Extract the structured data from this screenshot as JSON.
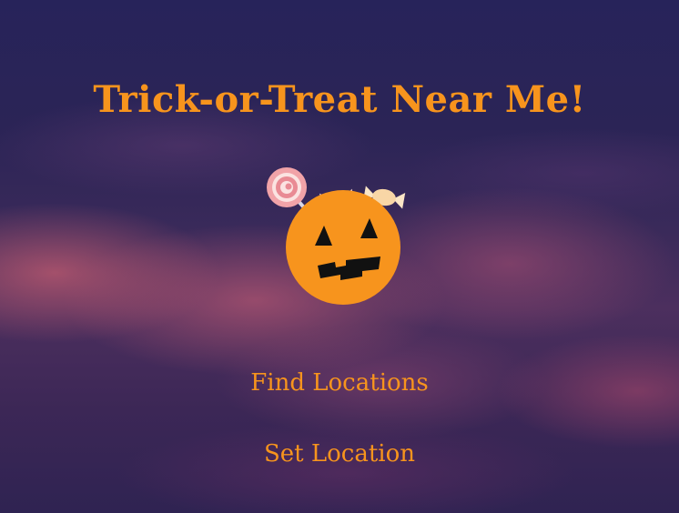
{
  "app": {
    "title": "Trick-or-Treat Near Me!"
  },
  "menu": {
    "items": [
      {
        "label": "Find Locations"
      },
      {
        "label": "Set Location"
      }
    ]
  },
  "icons": {
    "logo": "pumpkin-candy-bucket-icon"
  },
  "colors": {
    "accent": "#f7941d",
    "background_top": "#27235a",
    "cloud": "#b0546f"
  }
}
